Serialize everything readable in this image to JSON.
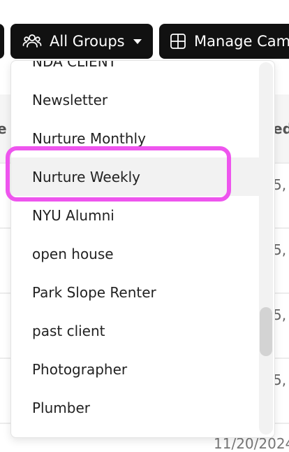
{
  "toolbar": {
    "groups_label": "All Groups",
    "manage_label": "Manage Campaigns"
  },
  "background": {
    "header_left_fragment": "e",
    "header_right_fragment": "ed",
    "row_fragments": [
      "5,",
      "5,",
      "5,",
      "5,"
    ],
    "date_partial": "11/20/2024"
  },
  "dropdown": {
    "items": [
      "NDA CLIENT",
      "Newsletter",
      "Nurture Monthly",
      "Nurture Weekly",
      "NYU Alumni",
      "open house",
      "Park Slope Renter",
      "past client",
      "Photographer",
      "Plumber"
    ],
    "highlighted_item": "Nurture Weekly"
  },
  "colors": {
    "button_bg": "#111111",
    "annotation": "#ee55ee",
    "highlight_bg": "#f2f2f2"
  }
}
